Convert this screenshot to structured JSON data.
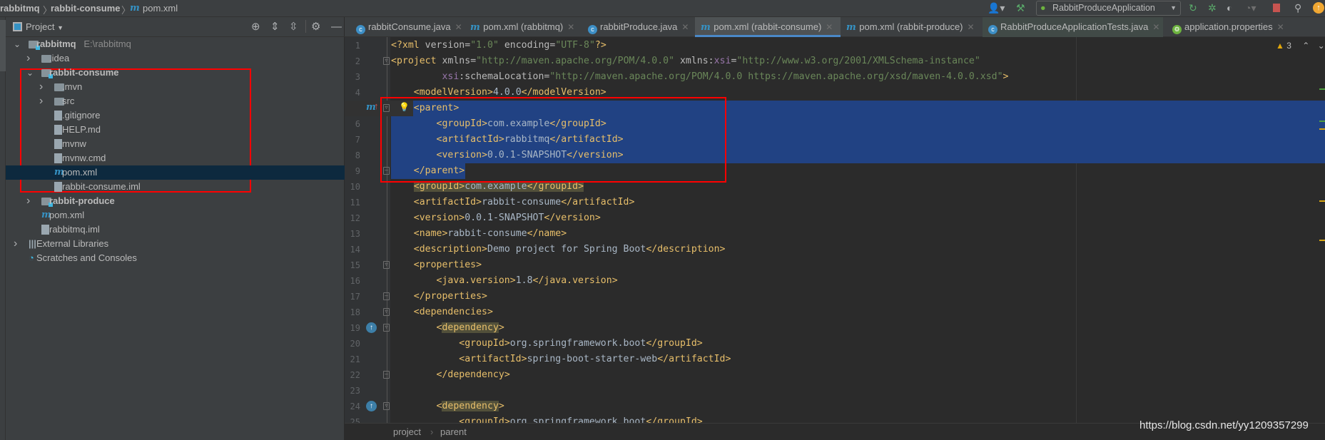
{
  "breadcrumb": [
    "rabbitmq",
    "rabbit-consume",
    "pom.xml"
  ],
  "toolbar": {
    "run_config": "RabbitProduceApplication",
    "icons": [
      "user-icon",
      "build-hammer-icon",
      "rerun-icon",
      "debug-icon",
      "coverage-icon",
      "profile-icon",
      "stop-icon",
      "search-icon",
      "update-icon"
    ]
  },
  "project_panel": {
    "title": "Project",
    "tree": [
      {
        "label": "rabbitmq",
        "hint": "E:\\rabbitmq",
        "level": 0,
        "type": "module",
        "expanded": true,
        "bold": true
      },
      {
        "label": ".idea",
        "level": 1,
        "type": "folder",
        "expanded": false
      },
      {
        "label": "rabbit-consume",
        "level": 1,
        "type": "module",
        "expanded": true,
        "bold": true
      },
      {
        "label": ".mvn",
        "level": 2,
        "type": "folder",
        "expanded": false
      },
      {
        "label": "src",
        "level": 2,
        "type": "folder",
        "expanded": false
      },
      {
        "label": ".gitignore",
        "level": 2,
        "type": "file"
      },
      {
        "label": "HELP.md",
        "level": 2,
        "type": "file"
      },
      {
        "label": "mvnw",
        "level": 2,
        "type": "file"
      },
      {
        "label": "mvnw.cmd",
        "level": 2,
        "type": "file"
      },
      {
        "label": "pom.xml",
        "level": 2,
        "type": "maven",
        "selected": true
      },
      {
        "label": "rabbit-consume.iml",
        "level": 2,
        "type": "file"
      },
      {
        "label": "rabbit-produce",
        "level": 1,
        "type": "module",
        "expanded": false,
        "bold": true
      },
      {
        "label": "pom.xml",
        "level": 1,
        "type": "maven"
      },
      {
        "label": "rabbitmq.iml",
        "level": 1,
        "type": "file"
      },
      {
        "label": "External Libraries",
        "level": 0,
        "type": "library",
        "expanded": false
      },
      {
        "label": "Scratches and Consoles",
        "level": 0,
        "type": "scratch"
      }
    ]
  },
  "tabs": [
    {
      "label": "rabbitConsume.java",
      "icon": "java-class-icon"
    },
    {
      "label": "pom.xml (rabbitmq)",
      "icon": "maven-icon"
    },
    {
      "label": "rabbitProduce.java",
      "icon": "java-class-icon"
    },
    {
      "label": "pom.xml (rabbit-consume)",
      "icon": "maven-icon",
      "active": true
    },
    {
      "label": "pom.xml (rabbit-produce)",
      "icon": "maven-icon"
    },
    {
      "label": "RabbitProduceApplicationTests.java",
      "icon": "java-class-icon"
    },
    {
      "label": "application.properties",
      "icon": "spring-properties-icon"
    }
  ],
  "editor": {
    "warnings": "3",
    "lines": [
      "<?xml version=\"1.0\" encoding=\"UTF-8\"?>",
      "<project xmlns=\"http://maven.apache.org/POM/4.0.0\" xmlns:xsi=\"http://www.w3.org/2001/XMLSchema-instance\"",
      "         xsi:schemaLocation=\"http://maven.apache.org/POM/4.0.0 https://maven.apache.org/xsd/maven-4.0.0.xsd\">",
      "    <modelVersion>4.0.0</modelVersion>",
      "    <parent>",
      "        <groupId>com.example</groupId>",
      "        <artifactId>rabbitmq</artifactId>",
      "        <version>0.0.1-SNAPSHOT</version>",
      "    </parent>",
      "    <groupId>com.example</groupId>",
      "    <artifactId>rabbit-consume</artifactId>",
      "    <version>0.0.1-SNAPSHOT</version>",
      "    <name>rabbit-consume</name>",
      "    <description>Demo project for Spring Boot</description>",
      "    <properties>",
      "        <java.version>1.8</java.version>",
      "    </properties>",
      "    <dependencies>",
      "        <dependency>",
      "            <groupId>org.springframework.boot</groupId>",
      "            <artifactId>spring-boot-starter-web</artifactId>",
      "        </dependency>",
      "",
      "        <dependency>",
      "            <groupId>org.springframework.boot</groupId>"
    ]
  },
  "status_breadcrumb": [
    "project",
    "parent"
  ],
  "watermark": "https://blog.csdn.net/yy1209357299",
  "colors": {
    "annotation_box": "#ff0000",
    "selection": "#214283",
    "tag": "#e8bf6a",
    "value": "#6a8759",
    "accent": "#4a88c7"
  }
}
